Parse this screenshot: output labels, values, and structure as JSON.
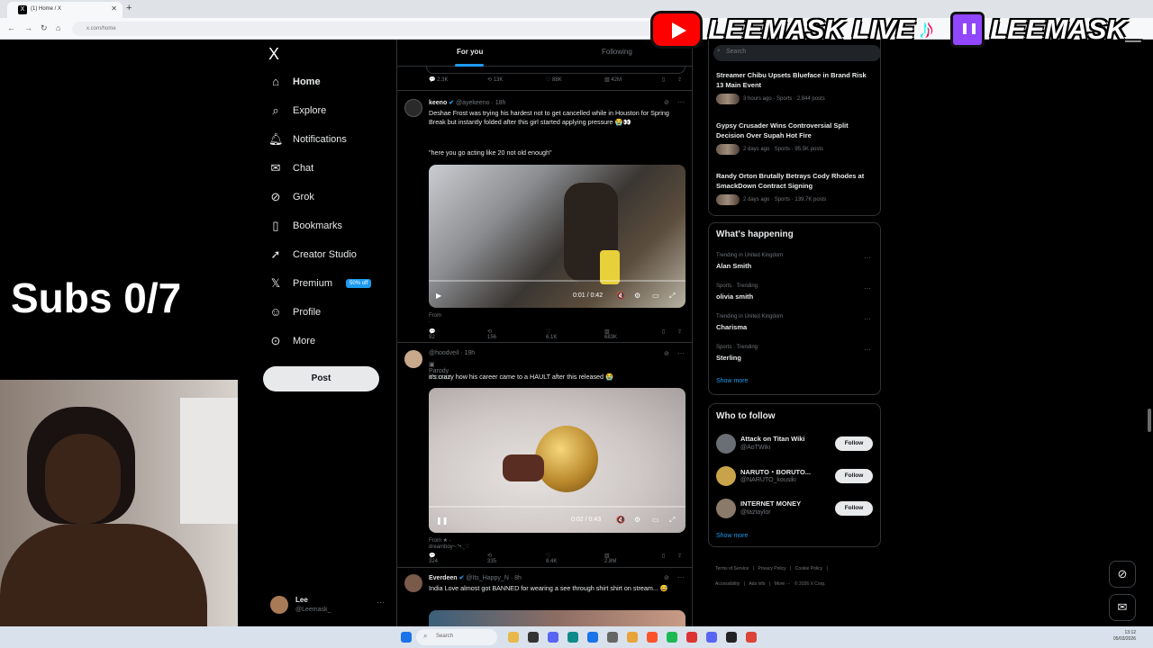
{
  "browser": {
    "tab_title": "(1) Home / X",
    "tab_icon": "X",
    "new_tab": "+",
    "url": "x.com/home"
  },
  "overlay": {
    "youtube_name": "LEEMASK LIVE",
    "twitch_name": "LEEMASK_",
    "subs_text": "Subs 0/7"
  },
  "nav": {
    "logo": "X",
    "items": [
      {
        "label": "Home",
        "icon": "home-icon"
      },
      {
        "label": "Explore",
        "icon": "search-icon"
      },
      {
        "label": "Notifications",
        "icon": "bell-icon"
      },
      {
        "label": "Chat",
        "icon": "mail-icon"
      },
      {
        "label": "Grok",
        "icon": "grok-icon"
      },
      {
        "label": "Bookmarks",
        "icon": "bookmark-icon"
      },
      {
        "label": "Creator Studio",
        "icon": "rocket-icon"
      },
      {
        "label": "Premium",
        "icon": "x-icon"
      },
      {
        "label": "Profile",
        "icon": "person-icon"
      },
      {
        "label": "More",
        "icon": "more-circle-icon"
      }
    ],
    "premium_badge": "50% off",
    "post_label": "Post",
    "account": {
      "name": "Lee",
      "handle": "@Leemask_",
      "more": "···"
    }
  },
  "timeline": {
    "tabs": [
      "For you",
      "Following"
    ],
    "top_actions": {
      "replies": "2.3K",
      "reposts": "13K",
      "likes": "88K",
      "views": "42M"
    },
    "tweets": [
      {
        "name": "keeno",
        "handle": "@ayekeeno",
        "time": "18h",
        "text": "Deshae Frost was trying his hardest not to get cancelled while in Houston for Spring Break but instantly folded after this girl started applying pressure 😭👀",
        "quote": "\"here you go acting like 20 not old enough\"",
        "video_time": "0:01 / 0:42",
        "from": "From .",
        "replies": "92",
        "reposts": "156",
        "likes": "6.1K",
        "views": "683K"
      },
      {
        "name": "",
        "handle": "@hoodveil",
        "time": "19h",
        "parody": "Parody account",
        "text": "it's crazy how his career came to a HAULT after this released 😭",
        "video_time": "0:02 / 0:43",
        "from": "From ★ -dreamboy~:*•.¸♡",
        "replies": "324",
        "reposts": "335",
        "likes": "8.4K",
        "views": "2.8M"
      },
      {
        "name": "Everdeen",
        "handle": "@Its_Happy_N",
        "time": "8h",
        "text": "India Love almost got BANNED for wearing a see through shirt shirt on stream... 😅"
      }
    ]
  },
  "right": {
    "search_placeholder": "Search",
    "news": [
      {
        "title": "Streamer Chibu Upsets Blueface in Brand Risk 13 Main Event",
        "meta": "3 hours ago · Sports · 2,844 posts"
      },
      {
        "title": "Gypsy Crusader Wins Controversial Split Decision Over Supah Hot Fire",
        "meta": "2 days ago · Sports · 95.5K posts"
      },
      {
        "title": "Randy Orton Brutally Betrays Cody Rhodes at SmackDown Contract Signing",
        "meta": "2 days ago · Sports · 139.7K posts"
      }
    ],
    "happening": {
      "title": "What's happening",
      "trends": [
        {
          "cat": "Trending in United Kingdom",
          "name": "Alan Smith"
        },
        {
          "cat": "Sports · Trending",
          "name": "olivia smith"
        },
        {
          "cat": "Trending in United Kingdom",
          "name": "Charisma"
        },
        {
          "cat": "Sports · Trending",
          "name": "Sterling"
        }
      ],
      "more": "···",
      "show_more": "Show more"
    },
    "wtf": {
      "title": "Who to follow",
      "accounts": [
        {
          "name": "Attack on Titan Wiki",
          "handle": "@AoTWiki",
          "color": "#6a6f75"
        },
        {
          "name": "NARUTO・BORUTO...",
          "handle": "@NARUTO_kousiki",
          "color": "#c9a34a"
        },
        {
          "name": "INTERNET MONEY",
          "handle": "@taztaylor",
          "color": "#8a7a6a"
        }
      ],
      "follow": "Follow",
      "show_more": "Show more"
    },
    "footer": [
      "Terms of Service",
      "Privacy Policy",
      "Cookie Policy",
      "Accessibility",
      "Ads info",
      "More ···",
      "© 2026 X Corp."
    ]
  },
  "taskbar": {
    "search": "Search",
    "time": "13:12",
    "date": "05/03/2026"
  },
  "colors": {
    "accent": "#1d9bf0",
    "bg": "#000000",
    "border": "#2f3336",
    "muted": "#71767b"
  }
}
